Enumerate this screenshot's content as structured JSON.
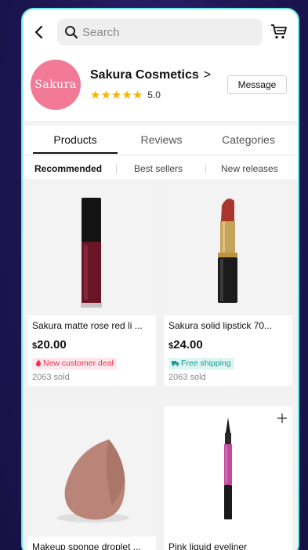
{
  "search": {
    "placeholder": "Search"
  },
  "shop": {
    "avatar_text": "Sakura",
    "name": "Sakura Cosmetics",
    "chevron": ">",
    "stars": "★★★★★",
    "rating": "5.0",
    "message_label": "Message"
  },
  "tabs": [
    {
      "label": "Products",
      "active": true
    },
    {
      "label": "Reviews",
      "active": false
    },
    {
      "label": "Categories",
      "active": false
    }
  ],
  "filters": [
    {
      "label": "Recommended",
      "active": true
    },
    {
      "label": "Best sellers",
      "active": false
    },
    {
      "label": "New releases",
      "active": false
    }
  ],
  "products": [
    {
      "title": "Sakura matte rose red li ...",
      "currency": "$",
      "price": "20.00",
      "badge": "New customer deal",
      "badge_type": "deal",
      "sold": "2063 sold"
    },
    {
      "title": "Sakura solid lipstick 70...",
      "currency": "$",
      "price": "24.00",
      "badge": "Free shipping",
      "badge_type": "ship",
      "sold": "2063 sold"
    },
    {
      "title": "Makeup sponge droplet ...",
      "currency": "",
      "price": "",
      "badge": "",
      "sold": ""
    },
    {
      "title": "Pink liquid eyeliner",
      "currency": "",
      "price": "",
      "badge": "",
      "sold": ""
    }
  ],
  "colors": {
    "accent_border": "#6ee7e0",
    "star": "#f1b400",
    "avatar_bg": "#f27a96",
    "deal_red": "#e8354f",
    "ship_teal": "#1b9e93"
  },
  "icons": [
    "back-icon",
    "search-icon",
    "cart-icon",
    "star-icon",
    "truck-icon",
    "flame-icon",
    "plus-icon"
  ]
}
